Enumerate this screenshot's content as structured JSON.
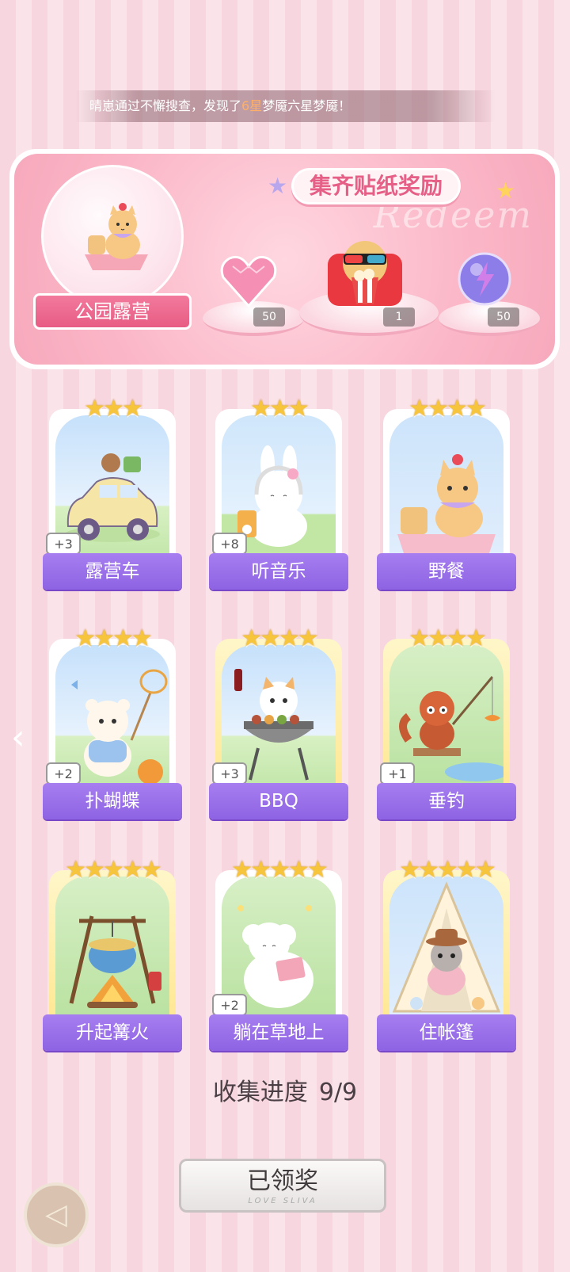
{
  "notice": {
    "before": "晴崽通过不懈搜查，发现了",
    "highlight": "6星",
    "after": "梦魇六星梦魇！"
  },
  "banner": {
    "title": "集齐贴纸奖励",
    "watermark": "Redeem",
    "place": "公园露营",
    "rewards": [
      {
        "icon": "pink-heart-gem-icon",
        "count": "50"
      },
      {
        "icon": "popcorn-cat-movie-icon",
        "count": "1"
      },
      {
        "icon": "purple-energy-orb-icon",
        "count": "50"
      }
    ]
  },
  "cards": [
    {
      "label": "露营车",
      "stars": 3,
      "plus": "+3",
      "gold": false
    },
    {
      "label": "听音乐",
      "stars": 3,
      "plus": "+8",
      "gold": false
    },
    {
      "label": "野餐",
      "stars": 4,
      "plus": "",
      "gold": false
    },
    {
      "label": "扑蝴蝶",
      "stars": 4,
      "plus": "+2",
      "gold": false
    },
    {
      "label": "BBQ",
      "stars": 4,
      "plus": "+3",
      "gold": true
    },
    {
      "label": "垂钓",
      "stars": 4,
      "plus": "+1",
      "gold": true
    },
    {
      "label": "升起篝火",
      "stars": 5,
      "plus": "",
      "gold": true
    },
    {
      "label": "躺在草地上",
      "stars": 5,
      "plus": "+2",
      "gold": false
    },
    {
      "label": "住帐篷",
      "stars": 5,
      "plus": "",
      "gold": true
    }
  ],
  "progress": {
    "label": "收集进度",
    "value": "9/9"
  },
  "claim": {
    "label": "已领奖",
    "sub": "LOVE SLIVA"
  },
  "nav": {
    "prev_glyph": "‹",
    "back_glyph": "◁"
  }
}
